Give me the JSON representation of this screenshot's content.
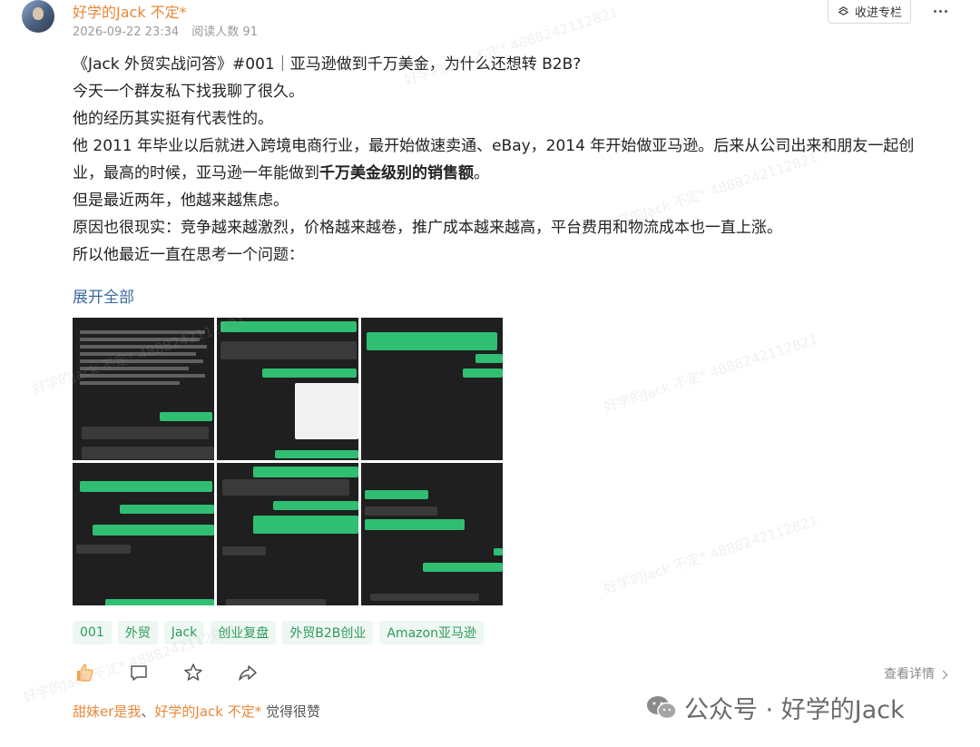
{
  "header": {
    "author": "好学的Jack 不定*",
    "date": "2026-09-22 23:34",
    "read_count": "阅读人数 91",
    "collect_label": "收进专栏"
  },
  "content": {
    "p1": "《Jack 外贸实战问答》#001｜亚马逊做到千万美金，为什么还想转 B2B?",
    "p2": "今天一个群友私下找我聊了很久。",
    "p3": "他的经历其实挺有代表性的。",
    "p4a": "他 2011 年毕业以后就进入跨境电商行业，最开始做速卖通、eBay，2014 年开始做亚马逊。后来从公司出来和朋友一起创业，最高的时候，亚马逊一年能做到",
    "p4b": "千万美金级别的销售额",
    "p4c": "。",
    "p5": "但是最近两年，他越来越焦虑。",
    "p6": "原因也很现实：竞争越来越激烈，价格越来越卷，推广成本越来越高，平台费用和物流成本也一直上涨。",
    "p7": "所以他最近一直在思考一个问题："
  },
  "expand_label": "展开全部",
  "tags": [
    "001",
    "外贸",
    "Jack",
    "创业复盘",
    "外贸B2B创业",
    "Amazon亚马逊"
  ],
  "actions": {
    "details_label": "查看详情"
  },
  "likes": {
    "name1": "甜妹er是我",
    "sep": "、",
    "name2": "好学的Jack 不定*",
    "suffix": " 觉得很赞"
  },
  "watermark": {
    "brand": "公众号 · 好学的Jack",
    "overlay_text": "好学的Jack 不定* 4888242112821"
  },
  "colors": {
    "accent_orange": "#e8883a",
    "link_blue": "#3b6aa0",
    "tag_green": "#2e9a5e",
    "chat_green": "#2fbe72"
  },
  "icons": [
    "more-icon",
    "collect-icon",
    "thumbs-up-icon",
    "comment-icon",
    "star-icon",
    "share-icon",
    "chevron-right-icon",
    "wechat-icon"
  ]
}
